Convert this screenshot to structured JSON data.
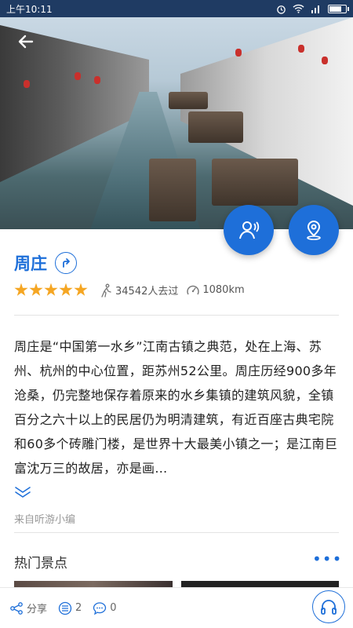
{
  "status_bar": {
    "time": "上午10:11"
  },
  "place": {
    "title": "周庄",
    "rating_stars": 5,
    "visitors": "34542人去过",
    "distance": "1080km"
  },
  "description": "周庄是“中国第一水乡”江南古镇之典范，处在上海、苏州、杭州的中心位置，距苏州52公里。周庄历经900多年沧桑，仍完整地保存着原来的水乡集镇的建筑风貌，全镇百分之六十以上的民居仍为明清建筑，有近百座古典宅院和60多个砖雕门楼，是世界十大最美小镇之一；是江南巨富沈万三的故居，亦是画…",
  "source": "来自听游小编",
  "popular": {
    "title": "热门景点",
    "more": "•••"
  },
  "bottom_bar": {
    "share_label": "分享",
    "list_count": "2",
    "comment_count": "0"
  },
  "colors": {
    "accent": "#1e6fd9",
    "star": "#f5a623",
    "status_bar": "#1f3b63"
  }
}
